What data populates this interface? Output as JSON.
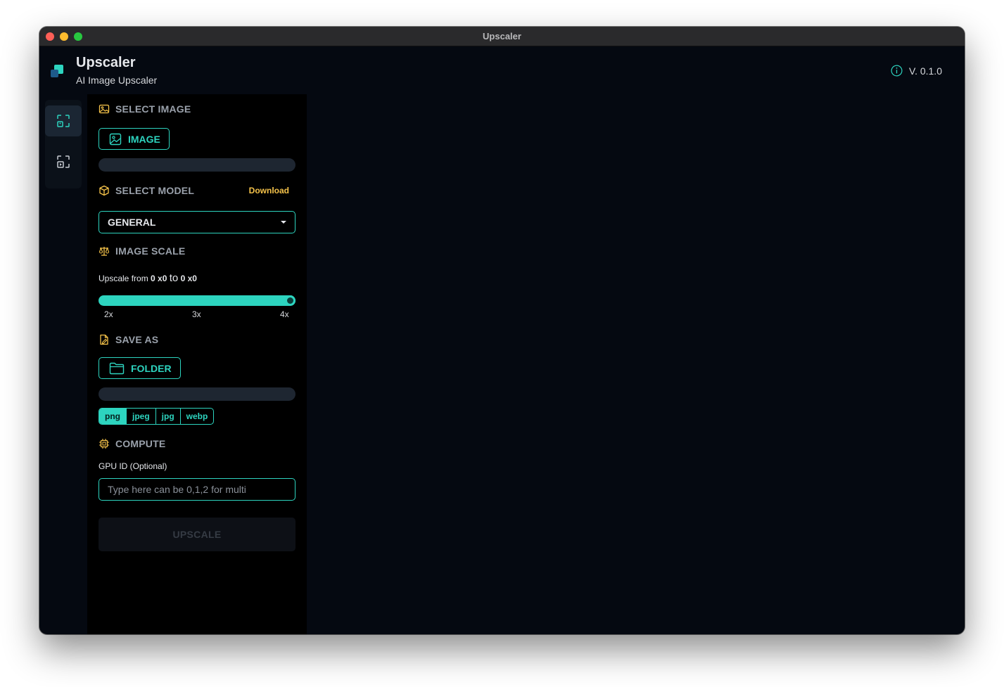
{
  "window": {
    "title": "Upscaler"
  },
  "header": {
    "app_name": "Upscaler",
    "subtitle": "AI Image Upscaler",
    "version": "V. 0.1.0"
  },
  "sidebar": {
    "items": [
      {
        "icon": "image-upscale-icon",
        "active": true
      },
      {
        "icon": "video-upscale-icon",
        "active": false
      }
    ]
  },
  "sections": {
    "select_image": {
      "title": "SELECT IMAGE",
      "button_label": "IMAGE",
      "path": ""
    },
    "select_model": {
      "title": "SELECT MODEL",
      "download_label": "Download",
      "selected_model": "GENERAL"
    },
    "image_scale": {
      "title": "IMAGE SCALE",
      "upscale_prefix": "Upscale from",
      "from_size": "0 x0",
      "to_word": "to",
      "to_size": "0 x0",
      "ticks": [
        "2x",
        "3x",
        "4x"
      ],
      "value_fraction": 1.0
    },
    "save_as": {
      "title": "SAVE AS",
      "button_label": "FOLDER",
      "path": "",
      "formats": [
        "png",
        "jpeg",
        "jpg",
        "webp"
      ],
      "selected_format": "png"
    },
    "compute": {
      "title": "COMPUTE",
      "gpu_label": "GPU ID (Optional)",
      "gpu_placeholder": "Type here can be 0,1,2 for multi",
      "gpu_value": ""
    }
  },
  "actions": {
    "upscale_label": "UPSCALE"
  },
  "colors": {
    "accent": "#2dd4bf",
    "icon_yellow": "#f6c34a",
    "background": "#050911",
    "panel": "#000000"
  }
}
